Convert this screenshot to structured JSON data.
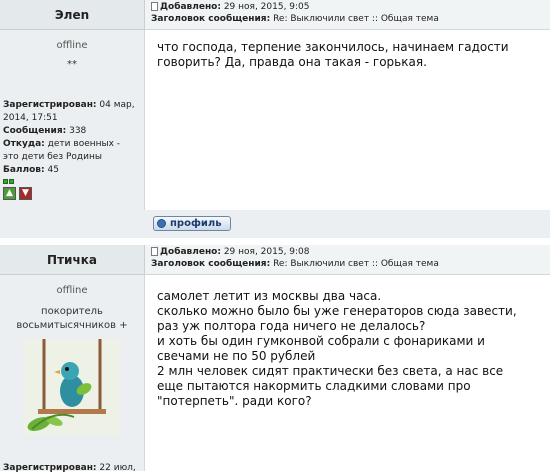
{
  "posts": [
    {
      "author": "Элеn",
      "added_label": "Добавлено:",
      "added_value": "29 ноя, 2015, 9:05",
      "subject_label": "Заголовок сообщения:",
      "subject_value": "Re: Выключили свет :: Общая тема",
      "status": "offline",
      "rank": "**",
      "registered_label": "Зарегистрирован:",
      "registered_value_1": "04 мар,",
      "registered_value_2": "2014, 17:51",
      "messages_label": "Сообщения:",
      "messages_value": "338",
      "from_label": "Откуда:",
      "from_value_1": "дети военных -",
      "from_value_2": "это дети без Родины",
      "points_label": "Баллов:",
      "points_value": "45",
      "text": [
        "что господа, терпение закончилось, начинаем гадости",
        "говорить? Да, правда она такая - горькая."
      ],
      "profile_button": "профиль"
    },
    {
      "author": "Птичка",
      "added_label": "Добавлено:",
      "added_value": "29 ноя, 2015, 9:08",
      "subject_label": "Заголовок сообщения:",
      "subject_value": "Re: Выключили свет :: Общая тема",
      "status": "offline",
      "rank_1": "покоритель",
      "rank_2": "восьмитысячников +",
      "registered_label": "Зарегистрирован:",
      "registered_value_1": "22 июл,",
      "text": [
        "самолет летит из москвы два часа.",
        "сколько можно было бы уже генераторов сюда завести,",
        "раз уж полтора года ничего не делалось?",
        "и хоть бы один гумконвой собрали с фонариками и",
        "свечами не по 50 рублей",
        "2 млн человек сидят практически без света, а нас все",
        "еще пытаются накормить сладкими словами про",
        "\"потерпеть\". ради кого?"
      ]
    }
  ],
  "colors": {
    "header_bg": "#e4e9ec",
    "sidebar_bg": "#ebeff1",
    "vote_up": "#4f9a3c",
    "vote_down": "#a52a2a"
  },
  "icons": {
    "post": "post-icon",
    "vote_up": "thumbs-up-icon",
    "vote_down": "thumbs-down-icon",
    "profile": "profile-icon"
  }
}
